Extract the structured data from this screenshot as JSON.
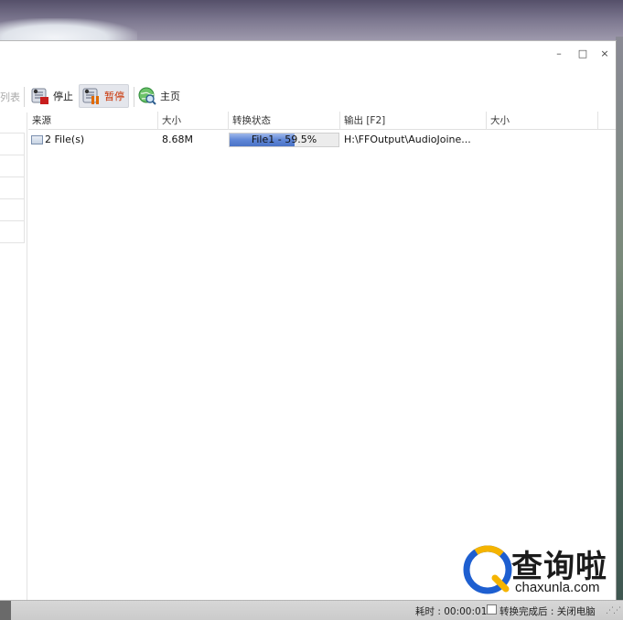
{
  "window_controls": {
    "minimize": "–",
    "maximize": "□",
    "close": "×"
  },
  "toolbar": {
    "left_fragment": "列表",
    "stop_label": "停止",
    "pause_label": "暂停",
    "home_label": "主页"
  },
  "columns": [
    "来源",
    "大小",
    "转换状态",
    "输出 [F2]",
    "大小"
  ],
  "rows": [
    {
      "source": "2 File(s)",
      "size": "8.68M",
      "status": "File1 - 59.5%",
      "progress": 0.595,
      "output": "H:\\FFOutput\\AudioJoine...",
      "out_size": ""
    }
  ],
  "statusbar": {
    "elapsed": "耗时 : 00:00:01",
    "shutdown_label": "转换完成后 : 关闭电脑",
    "shutdown_checked": false
  },
  "watermark": {
    "title": "查询啦",
    "url": "chaxunla.com"
  },
  "colors": {
    "progress_fill": "#5f86d7",
    "pause_active": "#c93000",
    "watermark_blue": "#1e5fd0"
  }
}
